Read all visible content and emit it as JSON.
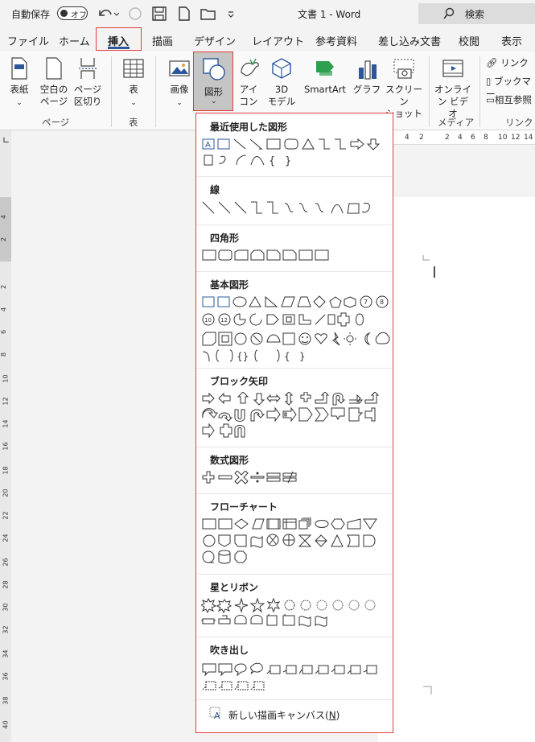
{
  "titlebar": {
    "autosave": "自動保存",
    "toggle": "オフ",
    "doc_title": "文書 1  -  Word",
    "search": "検索"
  },
  "tabs": [
    "ファイル",
    "ホーム",
    "挿入",
    "描画",
    "デザイン",
    "レイアウト",
    "参考資料",
    "差し込み文書",
    "校閲",
    "表示"
  ],
  "active_tab": "挿入",
  "ribbon": {
    "cover": "表紙",
    "blank_page": [
      "空白の",
      "ページ"
    ],
    "page_break": [
      "ページ",
      "区切り"
    ],
    "page_group": "ページ",
    "table": "表",
    "table_group": "表",
    "image": "画像",
    "shapes": "図形",
    "icons": [
      "アイ",
      "コン"
    ],
    "model3d": [
      "3D",
      "モデル"
    ],
    "smartart": "SmartArt",
    "graph": "グラフ",
    "screenshot": [
      "スクリーン",
      "ショット"
    ],
    "online_video": [
      "オンライ",
      "ン ビデオ"
    ],
    "media_group": "メディア",
    "link": "リンク",
    "bookmark": "ブックマー",
    "crossref": "相互参照",
    "link_group": "リンク"
  },
  "panel": {
    "sections": [
      "最近使用した図形",
      "線",
      "四角形",
      "基本図形",
      "ブロック矢印",
      "数式図形",
      "フローチャート",
      "星とリボン",
      "吹き出し"
    ],
    "new_canvas": "新しい描画キャンバス(N)",
    "new_canvas_pre": "新しい描画キャンバス(",
    "new_canvas_key": "N",
    "new_canvas_post": ")",
    "text_icon_glyph": "A",
    "circle_nums": [
      "7",
      "8",
      "10",
      "12"
    ]
  },
  "rulers": {
    "h_numbers": [
      "4",
      "2",
      "2",
      "4",
      "6",
      "8",
      "10",
      "12",
      "14"
    ],
    "v_numbers": [
      "4",
      "2",
      "2",
      "4",
      "6",
      "8",
      "10",
      "12",
      "14",
      "16",
      "18",
      "20",
      "22",
      "24",
      "26",
      "28",
      "30",
      "32",
      "34",
      "36",
      "38",
      "40"
    ]
  },
  "colors": {
    "accent": "#2b579a",
    "highlight": "#e23c3c"
  }
}
